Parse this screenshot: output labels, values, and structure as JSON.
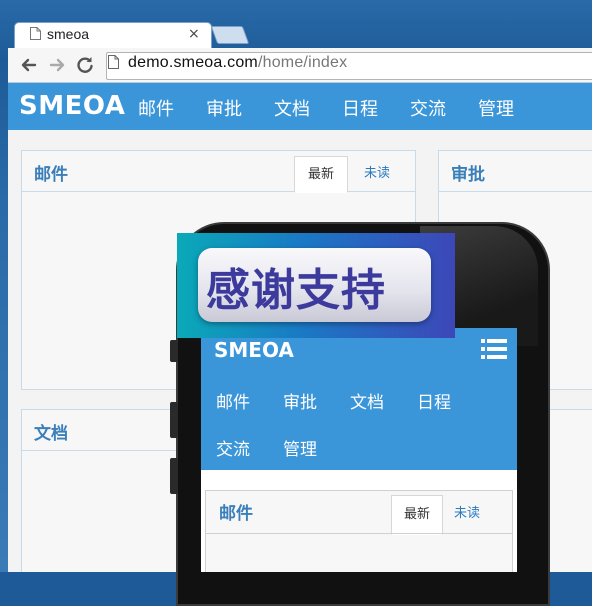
{
  "browser": {
    "tab_title": "smeoa",
    "tab_close": "×",
    "url_host": "demo.smeoa.com",
    "url_path": "/home/index"
  },
  "site": {
    "brand": "SMEOA",
    "nav": [
      "邮件",
      "审批",
      "文档",
      "日程",
      "交流",
      "管理"
    ],
    "panels": [
      {
        "title": "邮件",
        "tabs": [
          "最新",
          "未读"
        ]
      },
      {
        "title": "审批"
      },
      {
        "title": "文档"
      }
    ]
  },
  "mobile": {
    "brand": "SMEOA",
    "nav_row1": [
      "邮件",
      "审批",
      "文档",
      "日程"
    ],
    "nav_row2": [
      "交流",
      "管理"
    ],
    "panel": {
      "title": "邮件",
      "tab_new": "最新",
      "tab_unread": "未读"
    }
  },
  "banner": {
    "text": "感谢支持"
  },
  "colors": {
    "nav_blue": "#3b96d9",
    "panel_title_blue": "#3a7fb9",
    "link_blue": "#2a7ac0",
    "banner_text": "#3c3a9c"
  },
  "icons": [
    "page-icon",
    "back-icon",
    "forward-icon",
    "reload-icon",
    "close-icon",
    "menu-icon"
  ]
}
